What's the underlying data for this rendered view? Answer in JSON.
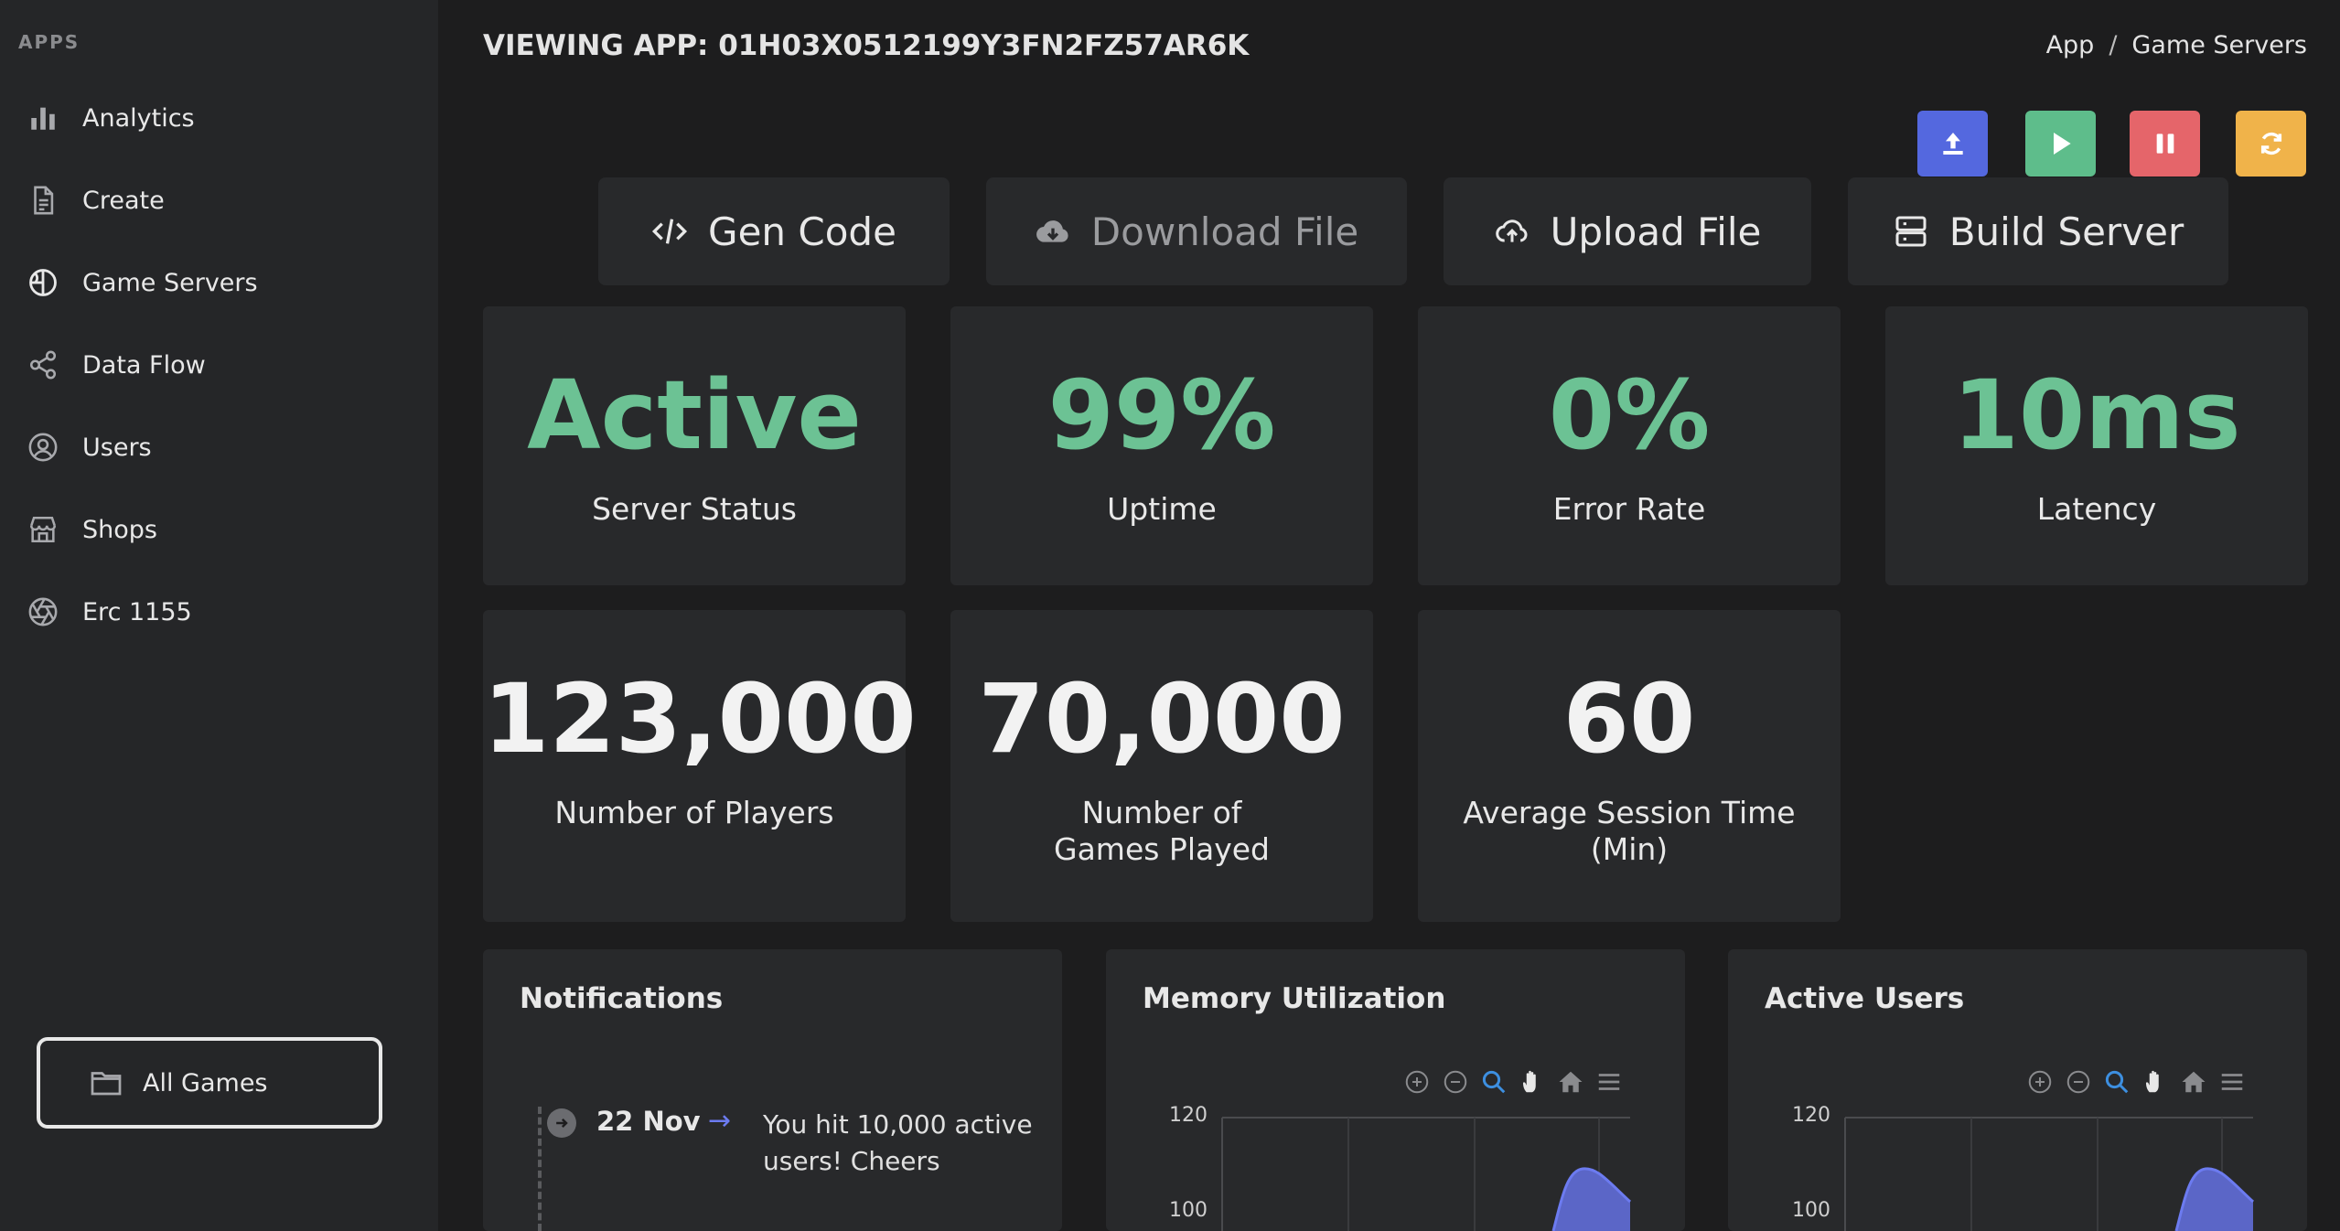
{
  "sidebar": {
    "section_label": "APPS",
    "items": [
      {
        "label": "Analytics",
        "icon": "bar-chart-icon"
      },
      {
        "label": "Create",
        "icon": "document-icon"
      },
      {
        "label": "Game Servers",
        "icon": "globe-icon"
      },
      {
        "label": "Data Flow",
        "icon": "share-icon"
      },
      {
        "label": "Users",
        "icon": "user-circle-icon"
      },
      {
        "label": "Shops",
        "icon": "store-icon"
      },
      {
        "label": "Erc 1155",
        "icon": "aperture-icon"
      }
    ],
    "all_games_label": "All Games"
  },
  "header": {
    "title": "VIEWING APP: 01H03X0512199Y3FN2FZ57AR6K",
    "breadcrumb": [
      "App",
      "Game Servers"
    ],
    "breadcrumb_sep": "/"
  },
  "action_icons": [
    {
      "name": "upload-action",
      "color": "#5468df"
    },
    {
      "name": "play-action",
      "color": "#5ebd8b"
    },
    {
      "name": "pause-action",
      "color": "#e5656a"
    },
    {
      "name": "refresh-action",
      "color": "#f0b34a"
    }
  ],
  "buttons": {
    "gen_code": "Gen Code",
    "download_file": "Download File",
    "upload_file": "Upload File",
    "build_server": "Build Server"
  },
  "stats": {
    "server_status": {
      "value": "Active",
      "label": "Server Status"
    },
    "uptime": {
      "value": "99%",
      "label": "Uptime"
    },
    "error_rate": {
      "value": "0%",
      "label": "Error Rate"
    },
    "latency": {
      "value": "10ms",
      "label": "Latency"
    },
    "players": {
      "value": "123,000",
      "label": "Number of Players"
    },
    "games_played": {
      "value": "70,000",
      "label": "Number of Games Played"
    },
    "session_time": {
      "value": "60",
      "label": "Average Session Time (Min)"
    }
  },
  "notifications": {
    "title": "Notifications",
    "items": [
      {
        "date": "22 Nov",
        "text": "You hit 10,000 active users! Cheers"
      }
    ]
  },
  "memory_chart": {
    "title": "Memory Utilization",
    "y_ticks": [
      "120",
      "100"
    ]
  },
  "active_users_chart": {
    "title": "Active Users",
    "y_ticks": [
      "120",
      "100"
    ]
  },
  "chart_data": [
    {
      "type": "area",
      "title": "Memory Utilization",
      "ylim": [
        100,
        120
      ],
      "grid": true,
      "color": "#6c7bf0"
    },
    {
      "type": "area",
      "title": "Active Users",
      "ylim": [
        100,
        120
      ],
      "grid": true,
      "color": "#6c7bf0"
    }
  ]
}
